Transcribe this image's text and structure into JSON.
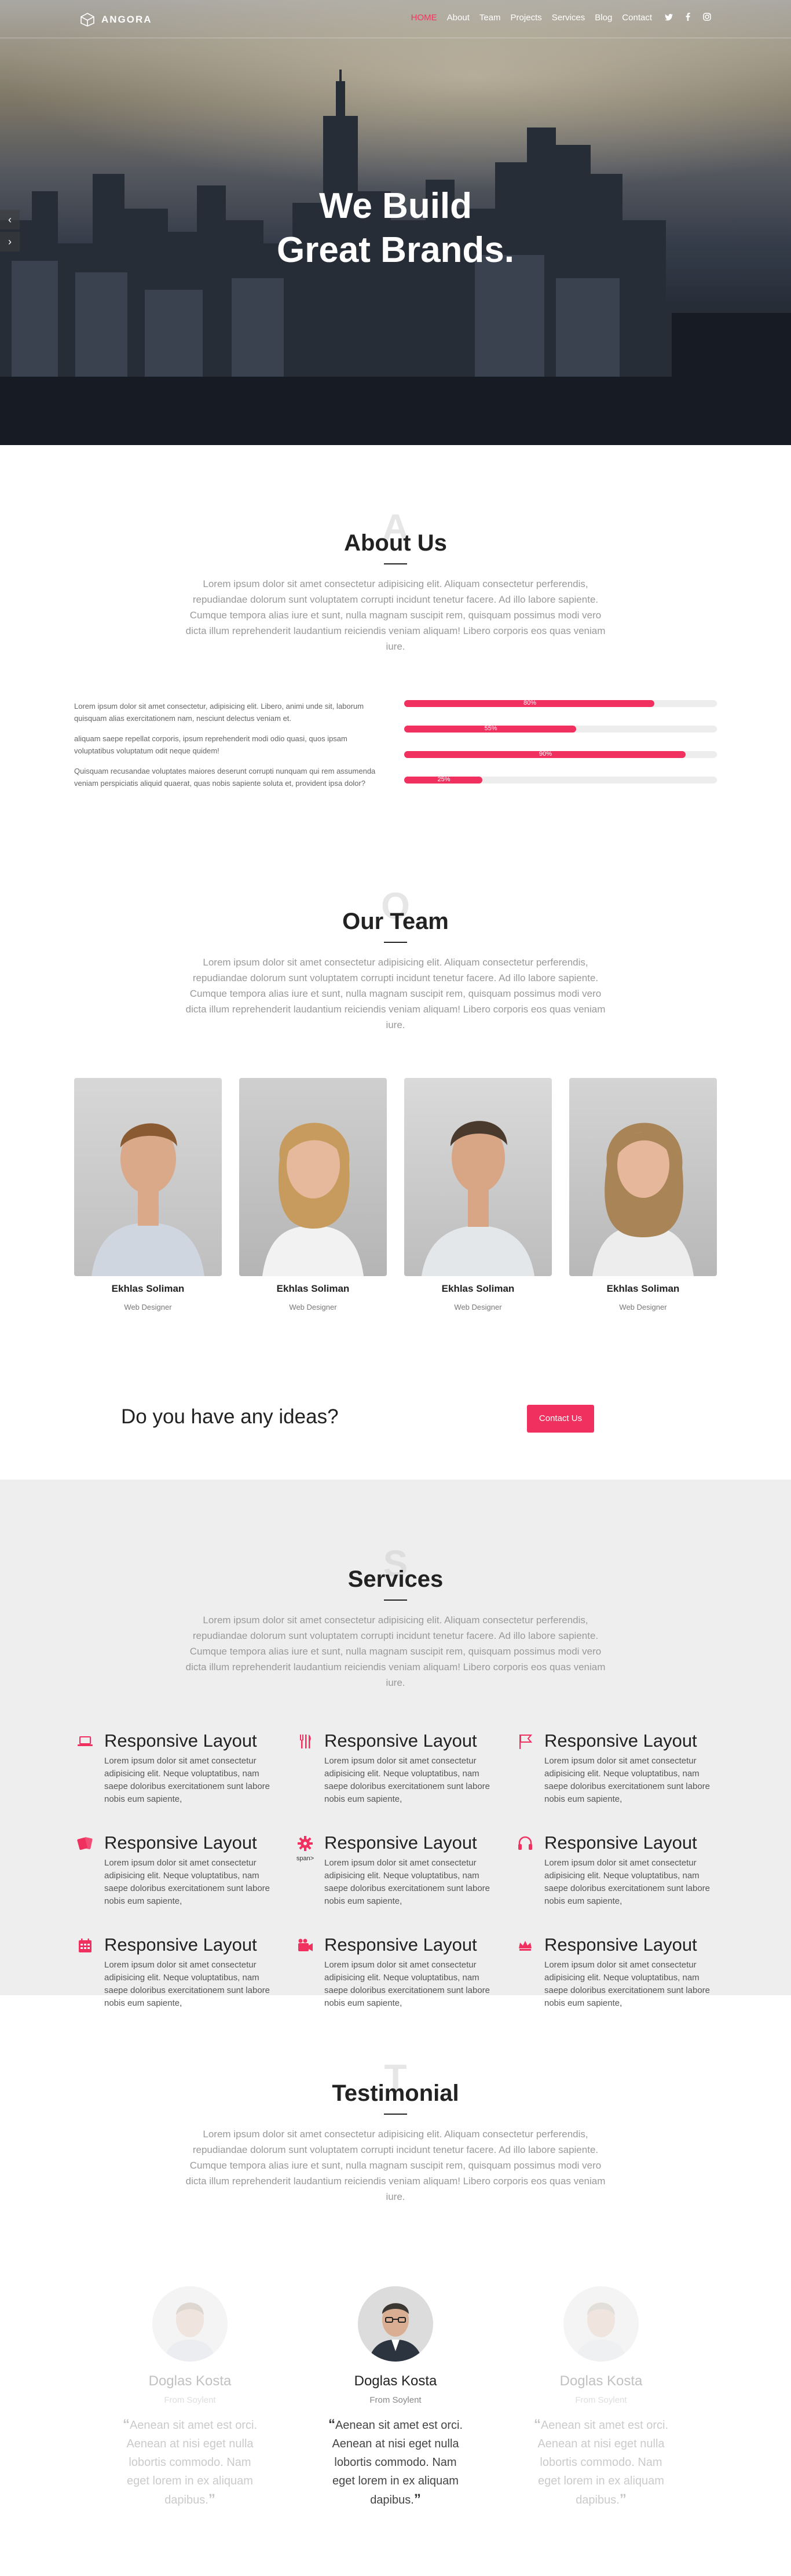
{
  "nav": {
    "brand": "ANGORA",
    "items": [
      "HOME",
      "About",
      "Team",
      "Projects",
      "Services",
      "Blog",
      "Contact"
    ],
    "social_icons": [
      "twitter-icon",
      "facebook-icon",
      "instagram-icon"
    ]
  },
  "hero": {
    "line1": "We Build",
    "line2": "Great Brands.",
    "prev_arrow": "‹",
    "next_arrow": "›"
  },
  "about": {
    "ghost": "A",
    "title": "About Us",
    "lead": "Lorem ipsum dolor sit amet consectetur adipisicing elit. Aliquam consectetur perferendis, repudiandae dolorum sunt voluptatem corrupti incidunt tenetur facere. Ad illo labore sapiente. Cumque tempora alias iure et sunt, nulla magnam suscipit rem, quisquam possimus modi vero dicta illum reprehenderit laudantium reiciendis veniam aliquam! Libero corporis eos quas veniam iure.",
    "paragraphs": [
      "Lorem ipsum dolor sit amet consectetur, adipisicing elit. Libero, animi unde sit, laborum quisquam alias exercitationem nam, nesciunt delectus veniam et.",
      "aliquam saepe repellat corporis, ipsum reprehenderit modi odio quasi, quos ipsam voluptatibus voluptatum odit neque quidem!",
      "Quisquam recusandae voluptates maiores deserunt corrupti nunquam qui rem assumenda veniam perspiciatis aliquid quaerat, quas nobis sapiente soluta et, provident ipsa dolor?"
    ],
    "skills": [
      {
        "label": "80%",
        "value": 80
      },
      {
        "label": "55%",
        "value": 55
      },
      {
        "label": "90%",
        "value": 90
      },
      {
        "label": "25%",
        "value": 25
      }
    ]
  },
  "team": {
    "ghost": "O",
    "title": "Our Team",
    "lead": "Lorem ipsum dolor sit amet consectetur adipisicing elit. Aliquam consectetur perferendis, repudiandae dolorum sunt voluptatem corrupti incidunt tenetur facere. Ad illo labore sapiente. Cumque tempora alias iure et sunt, nulla magnam suscipit rem, quisquam possimus modi vero dicta illum reprehenderit laudantium reiciendis veniam aliquam! Libero corporis eos quas veniam iure.",
    "members": [
      {
        "name": "Ekhlas Soliman",
        "role": "Web Designer"
      },
      {
        "name": "Ekhlas Soliman",
        "role": "Web Designer"
      },
      {
        "name": "Ekhlas Soliman",
        "role": "Web Designer"
      },
      {
        "name": "Ekhlas Soliman",
        "role": "Web Designer"
      }
    ]
  },
  "cta": {
    "text": "Do you have any ideas?",
    "button": "Contact Us"
  },
  "services": {
    "ghost": "S",
    "title": "Services",
    "lead": "Lorem ipsum dolor sit amet consectetur adipisicing elit. Aliquam consectetur perferendis, repudiandae dolorum sunt voluptatem corrupti incidunt tenetur facere. Ad illo labore sapiente. Cumque tempora alias iure et sunt, nulla magnam suscipit rem, quisquam possimus modi vero dicta illum reprehenderit laudantium reiciendis veniam aliquam! Libero corporis eos quas veniam iure.",
    "items": [
      {
        "icon": "laptop-icon",
        "title": "Responsive Layout",
        "text": "Lorem ipsum dolor sit amet consectetur adipisicing elit. Neque voluptatibus, nam saepe doloribus exercitationem sunt labore nobis eum sapiente,"
      },
      {
        "icon": "utensils-icon",
        "title": "Responsive Layout",
        "text": "Lorem ipsum dolor sit amet consectetur adipisicing elit. Neque voluptatibus, nam saepe doloribus exercitationem sunt labore nobis eum sapiente,"
      },
      {
        "icon": "flag-icon",
        "title": "Responsive Layout",
        "text": "Lorem ipsum dolor sit amet consectetur adipisicing elit. Neque voluptatibus, nam saepe doloribus exercitationem sunt labore nobis eum sapiente,"
      },
      {
        "icon": "cards-icon",
        "title": "Responsive Layout",
        "text": "Lorem ipsum dolor sit amet consectetur adipisicing elit. Neque voluptatibus, nam saepe doloribus exercitationem sunt labore nobis eum sapiente,"
      },
      {
        "icon": "gear-icon",
        "title": "Responsive Layout",
        "text": "Lorem ipsum dolor sit amet consectetur adipisicing elit. Neque voluptatibus, nam saepe doloribus exercitationem sunt labore nobis eum sapiente,",
        "note": "span>"
      },
      {
        "icon": "headphones-icon",
        "title": "Responsive Layout",
        "text": "Lorem ipsum dolor sit amet consectetur adipisicing elit. Neque voluptatibus, nam saepe doloribus exercitationem sunt labore nobis eum sapiente,"
      },
      {
        "icon": "calendar-icon",
        "title": "Responsive Layout",
        "text": "Lorem ipsum dolor sit amet consectetur adipisicing elit. Neque voluptatibus, nam saepe doloribus exercitationem sunt labore nobis eum sapiente,"
      },
      {
        "icon": "camera-icon",
        "title": "Responsive Layout",
        "text": "Lorem ipsum dolor sit amet consectetur adipisicing elit. Neque voluptatibus, nam saepe doloribus exercitationem sunt labore nobis eum sapiente,"
      },
      {
        "icon": "crown-icon",
        "title": "Responsive Layout",
        "text": "Lorem ipsum dolor sit amet consectetur adipisicing elit. Neque voluptatibus, nam saepe doloribus exercitationem sunt labore nobis eum sapiente,"
      }
    ]
  },
  "testimonial": {
    "ghost": "T",
    "title": "Testimonial",
    "lead": "Lorem ipsum dolor sit amet consectetur adipisicing elit. Aliquam consectetur perferendis, repudiandae dolorum sunt voluptatem corrupti incidunt tenetur facere. Ad illo labore sapiente. Cumque tempora alias iure et sunt, nulla magnam suscipit rem, quisquam possimus modi vero dicta illum reprehenderit laudantium reiciendis veniam aliquam! Libero corporis eos quas veniam iure.",
    "items": [
      {
        "name": "Doglas Kosta",
        "from": "From Soylent",
        "quote": "Aenean sit amet est orci. Aenean at nisi eget nulla lobortis commodo. Nam eget lorem in ex aliquam dapibus."
      },
      {
        "name": "Doglas Kosta",
        "from": "From Soylent",
        "quote": "Aenean sit amet est orci. Aenean at nisi eget nulla lobortis commodo. Nam eget lorem in ex aliquam dapibus."
      },
      {
        "name": "Doglas Kosta",
        "from": "From Soylent",
        "quote": "Aenean sit amet est orci. Aenean at nisi eget nulla lobortis commodo. Nam eget lorem in ex aliquam dapibus."
      }
    ]
  },
  "colors": {
    "accent": "#f0315f",
    "heading": "#222222",
    "muted": "#999999",
    "services_bg": "#eeeeee"
  }
}
